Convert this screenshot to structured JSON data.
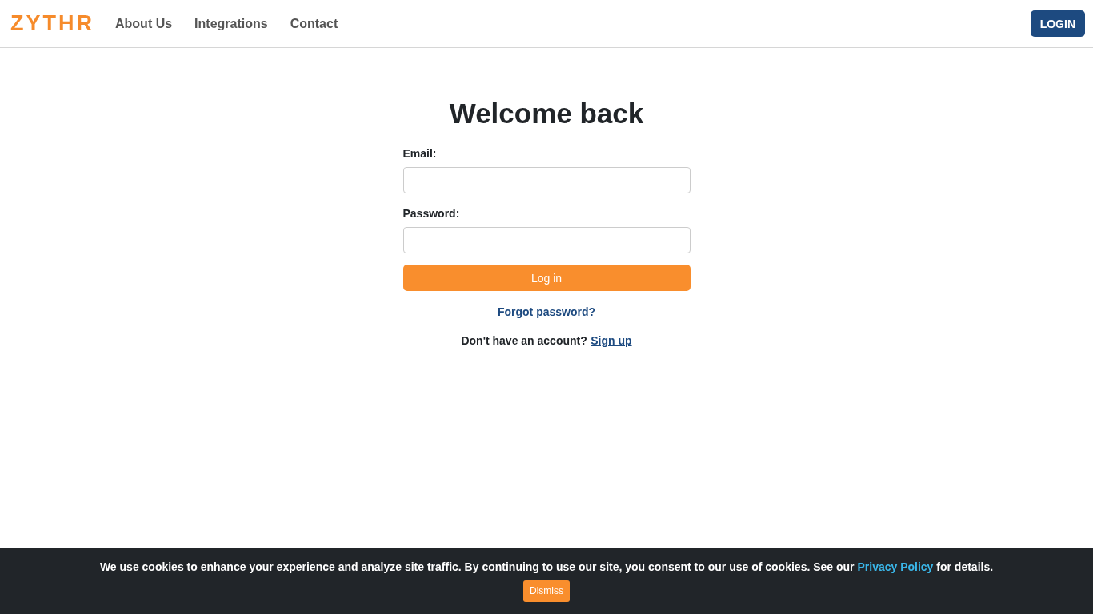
{
  "header": {
    "logo": "ZYTHR",
    "nav": [
      {
        "label": "About Us"
      },
      {
        "label": "Integrations"
      },
      {
        "label": "Contact"
      }
    ],
    "login_button": "LOGIN"
  },
  "form": {
    "title": "Welcome back",
    "fields": [
      {
        "label": "Email:"
      },
      {
        "label": "Password:"
      }
    ],
    "submit": "Log in",
    "forgot_link": "Forgot password?",
    "signup_prompt": "Don't have an account?",
    "signup_link": "Sign up"
  },
  "cookie_banner": {
    "text_before": "We use cookies to enhance your experience and analyze site traffic. By continuing to use our site, you consent to our use of cookies. See our",
    "link": "Privacy Policy",
    "text_after": "for details.",
    "dismiss": "Dismiss"
  }
}
